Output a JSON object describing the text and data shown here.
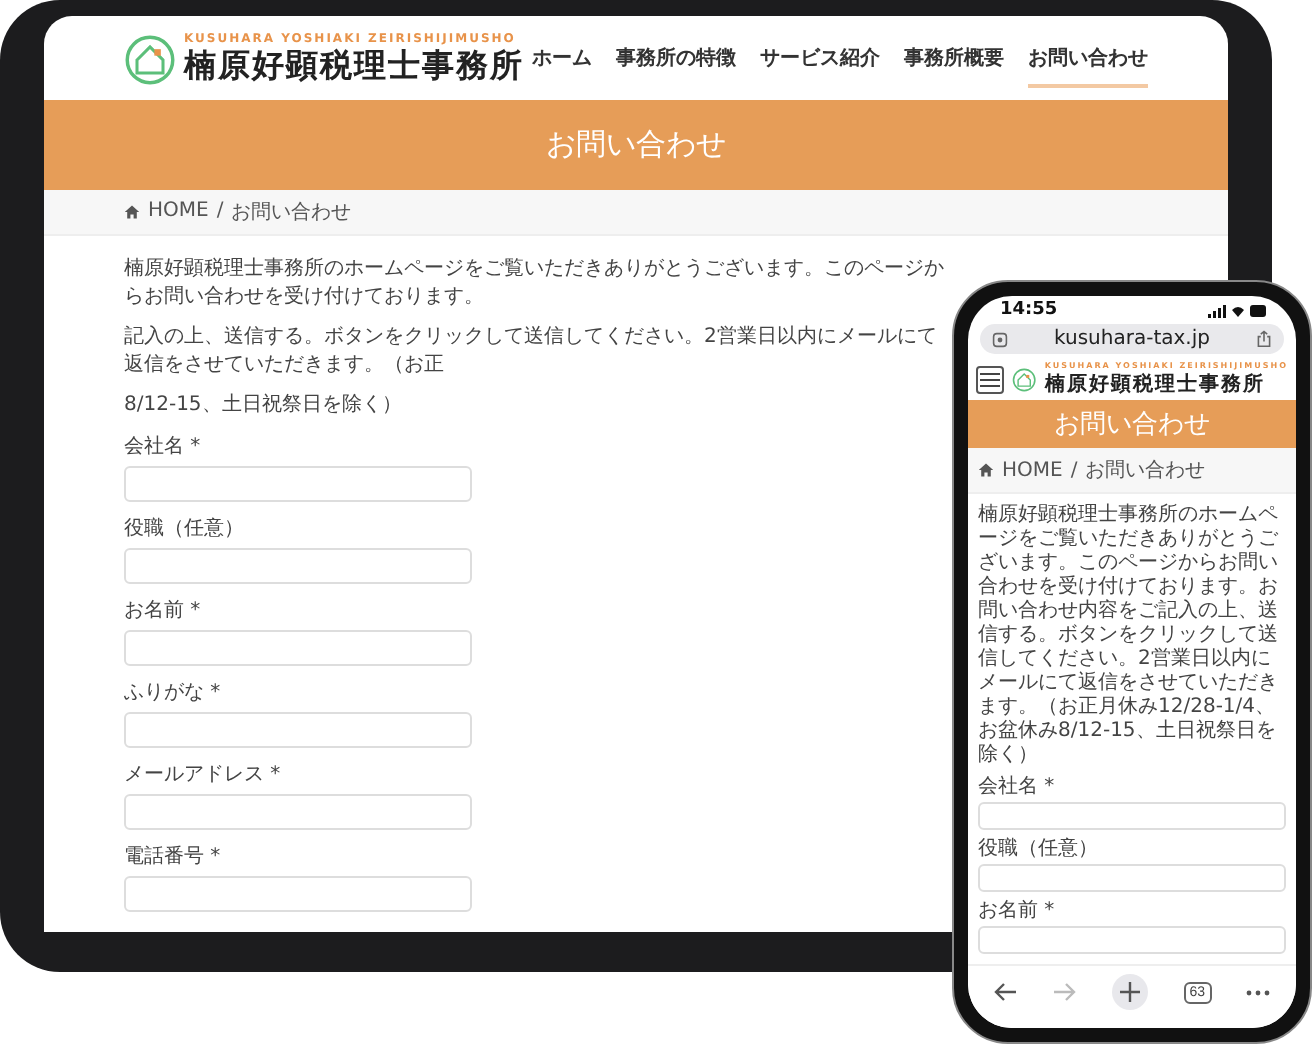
{
  "tablet": {
    "logo": {
      "romaji": "KUSUHARA YOSHIAKI ZEIRISHIJIMUSHO",
      "name": "楠原好顕税理士事務所"
    },
    "nav": [
      {
        "label": "ホーム",
        "selected": false
      },
      {
        "label": "事務所の特徴",
        "selected": false
      },
      {
        "label": "サービス紹介",
        "selected": false
      },
      {
        "label": "事務所概要",
        "selected": false
      },
      {
        "label": "お問い合わせ",
        "selected": true
      }
    ],
    "banner": {
      "title": "お問い合わせ"
    },
    "breadcrumb": {
      "home": "HOME",
      "separator": "/",
      "current": "お問い合わせ"
    },
    "intro": "楠原好顕税理士事務所のホームページをご覧いただきありがとうございます。このページからお問い合わせを受け付けております。",
    "intro_2": "記入の上、送信する。ボタンをクリックして送信してください。2営業日以内にメールにて返信をさせていただきます。（お正",
    "intro_3": "8/12-15、土日祝祭日を除く）",
    "fields": [
      {
        "label": "会社名 *"
      },
      {
        "label": "役職（任意）"
      },
      {
        "label": "お名前 *"
      },
      {
        "label": "ふりがな *"
      },
      {
        "label": "メールアドレス *"
      },
      {
        "label": "電話番号 *"
      }
    ]
  },
  "phone": {
    "status_bar": {
      "time": "14:55"
    },
    "address_bar": {
      "url": "kusuhara-tax.jp"
    },
    "logo": {
      "romaji": "KUSUHARA YOSHIAKI ZEIRISHIJIMUSHO",
      "name": "楠原好顕税理士事務所"
    },
    "banner": {
      "title": "お問い合わせ"
    },
    "breadcrumb": {
      "home": "HOME",
      "separator": "/",
      "current": "お問い合わせ"
    },
    "intro": "楠原好顕税理士事務所のホームページをご覧いただきありがとうございます。このページからお問い合わせを受け付けております。お問い合わせ内容をご記入の上、送信する。ボタンをクリックして送信してください。2営業日以内にメールにて返信をさせていただきます。（お正月休み12/28-1/4、お盆休み8/12-15、土日祝祭日を除く）",
    "fields": [
      {
        "label": "会社名 *"
      },
      {
        "label": "役職（任意）"
      },
      {
        "label": "お名前 *"
      }
    ],
    "toolbar": {
      "tab_count": "63",
      "forward_disabled": true
    }
  }
}
